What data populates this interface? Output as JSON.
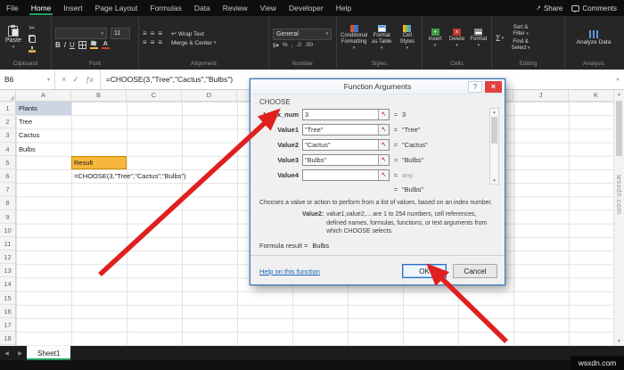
{
  "titlebar": {
    "tabs": [
      "File",
      "Home",
      "Insert",
      "Page Layout",
      "Formulas",
      "Data",
      "Review",
      "View",
      "Developer",
      "Help"
    ],
    "active_tab": "Home",
    "share": "Share",
    "comments": "Comments"
  },
  "ribbon": {
    "groups": [
      "Clipboard",
      "Font",
      "Alignment",
      "Number",
      "Styles",
      "Cells",
      "Editing",
      "Analysis"
    ],
    "paste": "Paste",
    "font_size": "11",
    "wrap_text": "Wrap Text",
    "merge_center": "Merge & Center",
    "number_format": "General",
    "styles": [
      "Conditional Formatting",
      "Format as Table",
      "Cell Styles"
    ],
    "cells": [
      "Insert",
      "Delete",
      "Format"
    ],
    "editing": [
      "Sort & Filter",
      "Find & Select"
    ],
    "analyze": "Analyze Data"
  },
  "formula_bar": {
    "name_box": "B6",
    "formula": "=CHOOSE(3,\"Tree\",\"Cactus\",\"Bulbs\")"
  },
  "grid": {
    "columns": [
      "A",
      "B",
      "C",
      "D",
      "E",
      "F",
      "G",
      "H",
      "I",
      "J",
      "K"
    ],
    "rows": 18,
    "cells": [
      {
        "ref": "A1",
        "text": "Plants",
        "fill": "#ccd5e3"
      },
      {
        "ref": "A2",
        "text": "Tree"
      },
      {
        "ref": "A3",
        "text": "Cactus"
      },
      {
        "ref": "A4",
        "text": "Bulbs"
      },
      {
        "ref": "B5",
        "text": "Result",
        "fill": "#f6b73c",
        "border": "#c98a00"
      },
      {
        "ref": "B6",
        "text": "=CHOOSE(3,\"Tree\",\"Cactus\",\"Bulbs\")"
      }
    ]
  },
  "dialog": {
    "title": "Function Arguments",
    "function_name": "CHOOSE",
    "fields": [
      {
        "label": "Index_num",
        "value": "3",
        "result": "3"
      },
      {
        "label": "Value1",
        "value": "\"Tree\"",
        "result": "\"Tree\""
      },
      {
        "label": "Value2",
        "value": "\"Cactus\"",
        "result": "\"Cactus\""
      },
      {
        "label": "Value3",
        "value": "\"Bulbs\"",
        "result": "\"Bulbs\""
      },
      {
        "label": "Value4",
        "value": "",
        "result": "any"
      }
    ],
    "result_preview": "\"Bulbs\"",
    "description": "Chooses a value or action to perform from a list of values, based on an index number.",
    "param_help_label": "Value2:",
    "param_help": "value1,value2,... are 1 to 254 numbers, cell references, defined names, formulas, functions, or text arguments from which CHOOSE selects.",
    "formula_result_label": "Formula result =",
    "formula_result": "Bulbs",
    "help_link": "Help on this function",
    "ok": "OK",
    "cancel": "Cancel"
  },
  "sheet_tabs": {
    "active": "Sheet1"
  },
  "watermark": "wsxdn.com"
}
